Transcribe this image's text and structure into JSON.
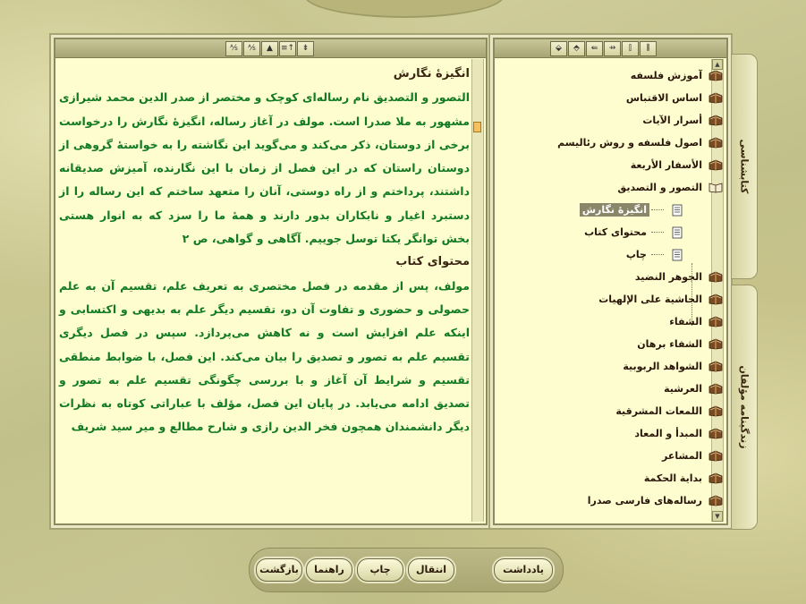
{
  "left_toolbar": {
    "buttons": [
      "⇟",
      "≡↑",
      "▲",
      "⅍",
      "⅍"
    ]
  },
  "right_toolbar": {
    "buttons": [
      "⬙",
      "⬘",
      "⇚",
      "⇸",
      "⫿",
      "⫼"
    ]
  },
  "text": {
    "heading1": "انگیزهٔ نگارش",
    "para1": "التصور و التصدیق نام رساله‌ای کوچک و مختصر از صدر الدین محمد شیرازی مشهور به ملا صدرا است. مولف در آغاز رساله، انگیزهٔ نگارش را درخواست برخی از دوستان، ذکر می‌کند و می‌گوید این نگاشته را به خواستهٔ گروهی از دوستان راستان که در این فصل از زمان با این نگارنده، آمیزش صدیقانه داشتند، پرداختم و از راه دوستی، آنان را متعهد ساختم که این رساله را از دستبرد اغیار و نابکاران بدور دارند و همهٔ ما را سزد که به انوار هستی بخش توانگر یکتا توسل جوییم. آگاهی و گواهی، ص ۲",
    "heading2": "محتوای کتاب",
    "para2": "مولف، پس از مقدمه در فصل مختصری به تعریف علم، تقسیم آن به علم حصولی و حضوری و تفاوت آن دو، تقسیم دیگر علم به بدیهی و اکتسابی و اینکه علم افزایش است و نه کاهش می‌پردازد. سپس در فصل دیگری تقسیم علم به تصور و تصدیق را بیان می‌کند. این فصل، با ضوابط منطقی تقسیم و شرایط آن آغاز و با بررسی چگونگی تقسیم علم به تصور و تصدیق ادامه می‌یابد. در پایان این فصل، مؤلف با عباراتی کوتاه به نظرات دیگر دانشمندان همچون فخر الدین رازی و شارح مطالع و میر سید شریف"
  },
  "tree": {
    "items": [
      {
        "label": "آموزش فلسفه",
        "type": "book"
      },
      {
        "label": "اساس الاقتباس",
        "type": "book"
      },
      {
        "label": "أسرار الآيات",
        "type": "book"
      },
      {
        "label": "اصول فلسفه و روش رئاليسم",
        "type": "book"
      },
      {
        "label": "الأسفار الأربعة",
        "type": "book"
      },
      {
        "label": "التصور و التصديق",
        "type": "open-book"
      },
      {
        "label": "انگیزهٔ نگارش",
        "type": "page",
        "selected": true
      },
      {
        "label": "محتوای کتاب",
        "type": "page"
      },
      {
        "label": "چاپ",
        "type": "page"
      },
      {
        "label": "الجوهر النضيد",
        "type": "book"
      },
      {
        "label": "الحاشية على الإلهيات",
        "type": "book"
      },
      {
        "label": "الشفاء",
        "type": "book"
      },
      {
        "label": "الشفاء برهان",
        "type": "book"
      },
      {
        "label": "الشواهد الربوبية",
        "type": "book"
      },
      {
        "label": "العرشية",
        "type": "book"
      },
      {
        "label": "اللمعات المشرقية",
        "type": "book"
      },
      {
        "label": "المبدأ و المعاد",
        "type": "book"
      },
      {
        "label": "المشاعر",
        "type": "book"
      },
      {
        "label": "بداية الحكمة",
        "type": "book"
      },
      {
        "label": "رساله‌های فارسی صدرا",
        "type": "book"
      }
    ]
  },
  "side_tabs": {
    "library": "کتابشناسی",
    "authors": "زندگینامه مؤلفان"
  },
  "bottom": {
    "back": "بازگشت",
    "help": "راهنما",
    "print": "چاپ",
    "transfer": "انتقال",
    "note": "یادداشت"
  }
}
